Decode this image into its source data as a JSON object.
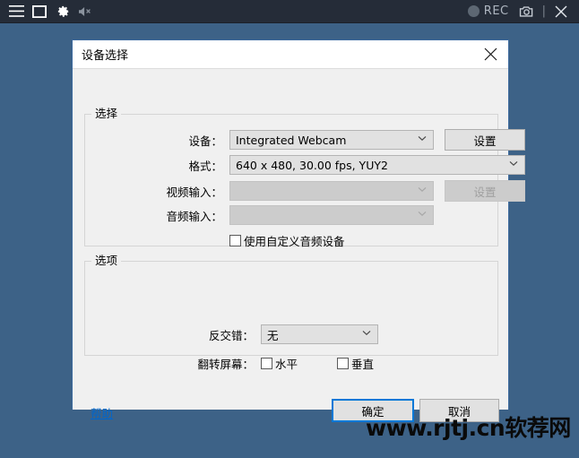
{
  "toolbar": {
    "left_icons": [
      {
        "name": "menu-icon",
        "label": "菜单"
      },
      {
        "name": "region-icon",
        "label": "区域"
      },
      {
        "name": "gear-icon",
        "label": "设置"
      },
      {
        "name": "speaker-mute-icon",
        "label": "静音"
      }
    ],
    "rec_label": "REC",
    "camera_label": "截图",
    "separator": "|",
    "close_label": "关闭"
  },
  "dialog": {
    "title": "设备选择",
    "close_label": "×",
    "groups": {
      "select": {
        "legend": "选择",
        "rows": [
          {
            "label": "设备：",
            "value": "Integrated Webcam",
            "disabled": false,
            "button": "设置",
            "button_disabled": false
          },
          {
            "label": "格式：",
            "value": "640 x 480, 30.00 fps, YUY2",
            "disabled": false,
            "button": null
          },
          {
            "label": "视频输入：",
            "value": "",
            "disabled": true,
            "button": "设置",
            "button_disabled": true
          },
          {
            "label": "音频输入：",
            "value": "",
            "disabled": true,
            "button": null
          }
        ],
        "checkbox": {
          "label": "使用自定义音频设备",
          "checked": false
        }
      },
      "options": {
        "legend": "选项",
        "deinterlace_label": "反交错：",
        "deinterlace_value": "无",
        "flip_label": "翻转屏幕：",
        "flip_horizontal": "水平",
        "flip_horizontal_checked": false,
        "flip_vertical": "垂直",
        "flip_vertical_checked": false
      }
    },
    "footer": {
      "help": "帮助",
      "ok": "确定",
      "cancel": "取消"
    }
  },
  "watermark": "www.rjtj.cn软荐网",
  "colors": {
    "desktop_background": "#3d6287",
    "toolbar_background": "#252c38",
    "dialog_border": "#3c6a9e",
    "dialog_background": "#f0f0f0",
    "accent": "#0078d7",
    "link": "#0066cc"
  }
}
